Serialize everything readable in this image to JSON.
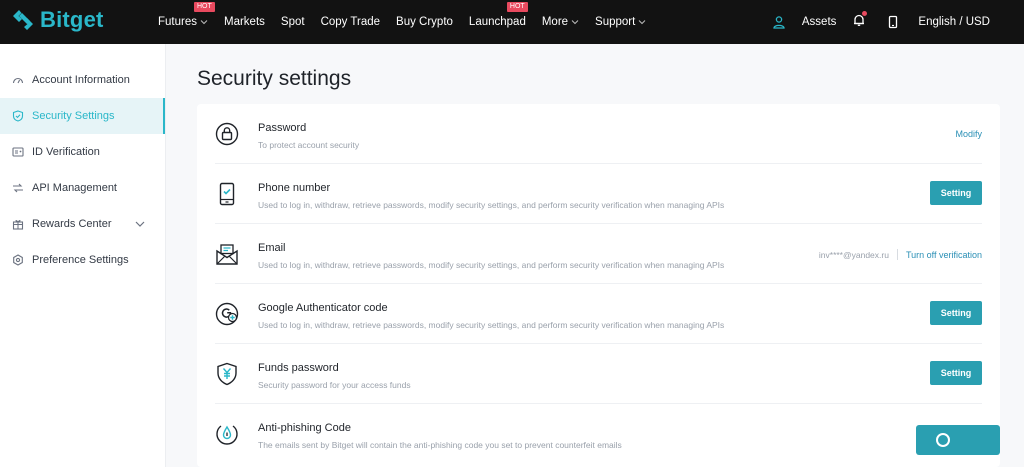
{
  "brand": {
    "name": "Bitget",
    "color": "#2ab7c9"
  },
  "nav": {
    "items": [
      {
        "label": "Futures",
        "badge": "HOT",
        "dropdown": true
      },
      {
        "label": "Markets"
      },
      {
        "label": "Spot"
      },
      {
        "label": "Copy Trade"
      },
      {
        "label": "Buy Crypto"
      },
      {
        "label": "Launchpad",
        "badge": "HOT"
      },
      {
        "label": "More",
        "dropdown": true
      },
      {
        "label": "Support",
        "dropdown": true
      }
    ],
    "assets_label": "Assets",
    "language_label": "English / USD",
    "icons": [
      "user-icon",
      "bell-icon",
      "phone-icon"
    ]
  },
  "sidebar": {
    "items": [
      {
        "label": "Account Information",
        "icon": "gauge-icon"
      },
      {
        "label": "Security Settings",
        "icon": "shield-icon",
        "active": true
      },
      {
        "label": "ID Verification",
        "icon": "id-card-icon"
      },
      {
        "label": "API Management",
        "icon": "api-icon"
      },
      {
        "label": "Rewards Center",
        "icon": "gift-icon",
        "expandable": true
      },
      {
        "label": "Preference Settings",
        "icon": "settings-icon"
      }
    ]
  },
  "page": {
    "title": "Security settings"
  },
  "security": {
    "rows": [
      {
        "title": "Password",
        "desc": "To protect account security",
        "action": "Modify",
        "icon": "lock-icon"
      },
      {
        "title": "Phone number",
        "desc": "Used to log in, withdraw, retrieve passwords, modify security settings, and perform security verification when managing APIs",
        "action": "Setting",
        "icon": "phone-check-icon"
      },
      {
        "title": "Email",
        "desc": "Used to log in, withdraw, retrieve passwords, modify security settings, and perform security verification when managing APIs",
        "value": "inv****@yandex.ru",
        "action": "Turn off verification",
        "icon": "email-icon"
      },
      {
        "title": "Google Authenticator code",
        "desc": "Used to log in, withdraw, retrieve passwords, modify security settings, and perform security verification when managing APIs",
        "action": "Setting",
        "icon": "google-auth-icon"
      },
      {
        "title": "Funds password",
        "desc": "Security password for your access funds",
        "action": "Setting",
        "icon": "yen-shield-icon"
      },
      {
        "title": "Anti-phishing Code",
        "desc": "The emails sent by Bitget will contain the anti-phishing code you set to prevent counterfeit emails",
        "action": "",
        "icon": "anti-phishing-icon"
      }
    ]
  },
  "colors": {
    "accent": "#2ab7c9",
    "button": "#2a9fb1",
    "link": "#2a8fb5",
    "hot": "#e84a5f"
  }
}
